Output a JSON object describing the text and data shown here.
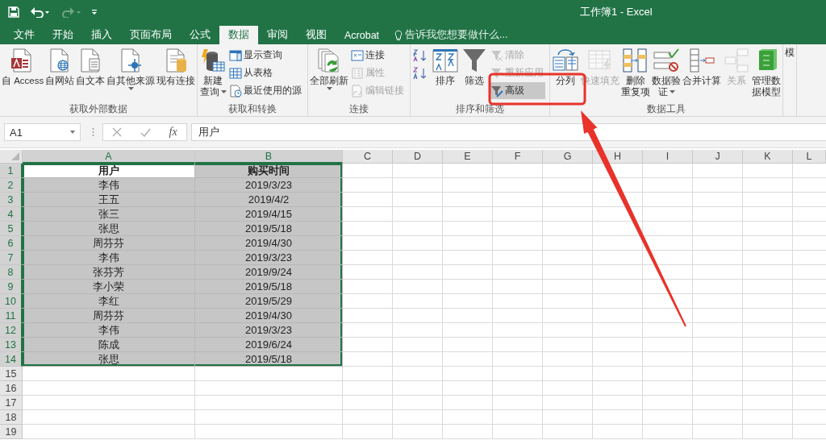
{
  "window": {
    "title": "工作簿1 - Excel"
  },
  "tabs": [
    {
      "label": "文件",
      "selected": false
    },
    {
      "label": "开始",
      "selected": false
    },
    {
      "label": "插入",
      "selected": false
    },
    {
      "label": "页面布局",
      "selected": false
    },
    {
      "label": "公式",
      "selected": false
    },
    {
      "label": "数据",
      "selected": true
    },
    {
      "label": "审阅",
      "selected": false
    },
    {
      "label": "视图",
      "selected": false
    },
    {
      "label": "Acrobat",
      "selected": false
    }
  ],
  "search": {
    "placeholder": "告诉我您想要做什么..."
  },
  "ribbon_groups": [
    {
      "label": "获取外部数据",
      "items": [
        {
          "kind": "large",
          "lines": [
            "自 Access"
          ],
          "dropdown": false,
          "disabled": false
        },
        {
          "kind": "large",
          "lines": [
            "自网站"
          ],
          "dropdown": false,
          "disabled": false
        },
        {
          "kind": "large",
          "lines": [
            "自文本"
          ],
          "dropdown": false,
          "disabled": false
        },
        {
          "kind": "large",
          "lines": [
            "自其他来源"
          ],
          "dropdown": true,
          "disabled": false
        },
        {
          "kind": "large",
          "lines": [
            "现有连接"
          ],
          "dropdown": false,
          "disabled": false
        }
      ]
    },
    {
      "label": "获取和转换",
      "items": [
        {
          "kind": "large",
          "lines": [
            "新建",
            "查询"
          ],
          "dropdown": true,
          "disabled": false
        },
        {
          "kind": "stack",
          "items": [
            {
              "label": "显示查询",
              "disabled": false,
              "selected": false
            },
            {
              "label": "从表格",
              "disabled": false,
              "selected": false
            },
            {
              "label": "最近使用的源",
              "disabled": false,
              "selected": false
            }
          ]
        }
      ]
    },
    {
      "label": "连接",
      "items": [
        {
          "kind": "large",
          "lines": [
            "全部刷新"
          ],
          "dropdown": true,
          "disabled": false
        },
        {
          "kind": "stack",
          "items": [
            {
              "label": "连接",
              "disabled": false,
              "selected": false
            },
            {
              "label": "属性",
              "disabled": true,
              "selected": false
            },
            {
              "label": "编辑链接",
              "disabled": true,
              "selected": false
            }
          ]
        }
      ]
    },
    {
      "label": "排序和筛选",
      "items": [
        {
          "kind": "stack",
          "items": [
            {
              "disabled": false,
              "selected": false
            },
            {
              "disabled": false,
              "selected": false
            }
          ]
        },
        {
          "kind": "large",
          "lines": [
            "排序"
          ],
          "dropdown": false,
          "disabled": false
        },
        {
          "kind": "large",
          "lines": [
            "筛选"
          ],
          "dropdown": false,
          "disabled": false
        },
        {
          "kind": "stack",
          "items": [
            {
              "label": "清除",
              "disabled": true,
              "selected": false
            },
            {
              "label": "重新应用",
              "disabled": true,
              "selected": false
            },
            {
              "label": "高级",
              "disabled": false,
              "selected": true
            }
          ]
        }
      ]
    },
    {
      "label": "数据工具",
      "items": [
        {
          "kind": "large",
          "lines": [
            "分列"
          ],
          "dropdown": false,
          "disabled": false
        },
        {
          "kind": "large",
          "lines": [
            "快速填充"
          ],
          "dropdown": false,
          "disabled": true
        },
        {
          "kind": "large",
          "lines": [
            "删除",
            "重复项"
          ],
          "dropdown": false,
          "disabled": false
        },
        {
          "kind": "large",
          "lines": [
            "数据验",
            "证"
          ],
          "dropdown": true,
          "disabled": false
        },
        {
          "kind": "large",
          "lines": [
            "合并计算"
          ],
          "dropdown": false,
          "disabled": false
        },
        {
          "kind": "large",
          "lines": [
            "关系"
          ],
          "dropdown": false,
          "disabled": true
        },
        {
          "kind": "large",
          "lines": [
            "管理数",
            "据模型"
          ],
          "dropdown": false,
          "disabled": false
        }
      ]
    },
    {
      "items": [
        {
          "kind": "large",
          "lines": [
            "模"
          ],
          "dropdown": false,
          "disabled": false
        }
      ]
    }
  ],
  "formula_bar": {
    "name_box": "A1",
    "function_label": "fx",
    "formula": "用户"
  },
  "grid": {
    "columns": [
      {
        "label": "A",
        "selected": true
      },
      {
        "label": "B",
        "selected": true
      },
      {
        "label": "C",
        "selected": false
      },
      {
        "label": "D",
        "selected": false
      },
      {
        "label": "E",
        "selected": false
      },
      {
        "label": "F",
        "selected": false
      },
      {
        "label": "G",
        "selected": false
      },
      {
        "label": "H",
        "selected": false
      },
      {
        "label": "I",
        "selected": false
      },
      {
        "label": "J",
        "selected": false
      },
      {
        "label": "K",
        "selected": false
      },
      {
        "label": "L",
        "selected": false
      }
    ],
    "rows": [
      {
        "number": "1",
        "selected": true,
        "cells": [
          {
            "text": "用户",
            "selected": true,
            "active": true
          },
          {
            "text": "购买时间",
            "selected": true,
            "active": false
          }
        ]
      },
      {
        "number": "2",
        "selected": true,
        "cells": [
          {
            "text": "李伟",
            "selected": true,
            "active": false
          },
          {
            "text": "2019/3/23",
            "selected": true,
            "active": false
          }
        ]
      },
      {
        "number": "3",
        "selected": true,
        "cells": [
          {
            "text": "王五",
            "selected": true,
            "active": false
          },
          {
            "text": "2019/4/2",
            "selected": true,
            "active": false
          }
        ]
      },
      {
        "number": "4",
        "selected": true,
        "cells": [
          {
            "text": "张三",
            "selected": true,
            "active": false
          },
          {
            "text": "2019/4/15",
            "selected": true,
            "active": false
          }
        ]
      },
      {
        "number": "5",
        "selected": true,
        "cells": [
          {
            "text": "张思",
            "selected": true,
            "active": false
          },
          {
            "text": "2019/5/18",
            "selected": true,
            "active": false
          }
        ]
      },
      {
        "number": "6",
        "selected": true,
        "cells": [
          {
            "text": "周芬芬",
            "selected": true,
            "active": false
          },
          {
            "text": "2019/4/30",
            "selected": true,
            "active": false
          }
        ]
      },
      {
        "number": "7",
        "selected": true,
        "cells": [
          {
            "text": "李伟",
            "selected": true,
            "active": false
          },
          {
            "text": "2019/3/23",
            "selected": true,
            "active": false
          }
        ]
      },
      {
        "number": "8",
        "selected": true,
        "cells": [
          {
            "text": "张芬芳",
            "selected": true,
            "active": false
          },
          {
            "text": "2019/9/24",
            "selected": true,
            "active": false
          }
        ]
      },
      {
        "number": "9",
        "selected": true,
        "cells": [
          {
            "text": "李小荣",
            "selected": true,
            "active": false
          },
          {
            "text": "2019/5/18",
            "selected": true,
            "active": false
          }
        ]
      },
      {
        "number": "10",
        "selected": true,
        "cells": [
          {
            "text": "李红",
            "selected": true,
            "active": false
          },
          {
            "text": "2019/5/29",
            "selected": true,
            "active": false
          }
        ]
      },
      {
        "number": "11",
        "selected": true,
        "cells": [
          {
            "text": "周芬芬",
            "selected": true,
            "active": false
          },
          {
            "text": "2019/4/30",
            "selected": true,
            "active": false
          }
        ]
      },
      {
        "number": "12",
        "selected": true,
        "cells": [
          {
            "text": "李伟",
            "selected": true,
            "active": false
          },
          {
            "text": "2019/3/23",
            "selected": true,
            "active": false
          }
        ]
      },
      {
        "number": "13",
        "selected": true,
        "cells": [
          {
            "text": "陈成",
            "selected": true,
            "active": false
          },
          {
            "text": "2019/6/24",
            "selected": true,
            "active": false
          }
        ]
      },
      {
        "number": "14",
        "selected": true,
        "cells": [
          {
            "text": "张思",
            "selected": true,
            "active": false
          },
          {
            "text": "2019/5/18",
            "selected": true,
            "active": false
          }
        ]
      },
      {
        "number": "15",
        "selected": false
      },
      {
        "number": "16",
        "selected": false
      },
      {
        "number": "17",
        "selected": false
      },
      {
        "number": "18",
        "selected": false
      },
      {
        "number": "19",
        "selected": false
      }
    ]
  }
}
